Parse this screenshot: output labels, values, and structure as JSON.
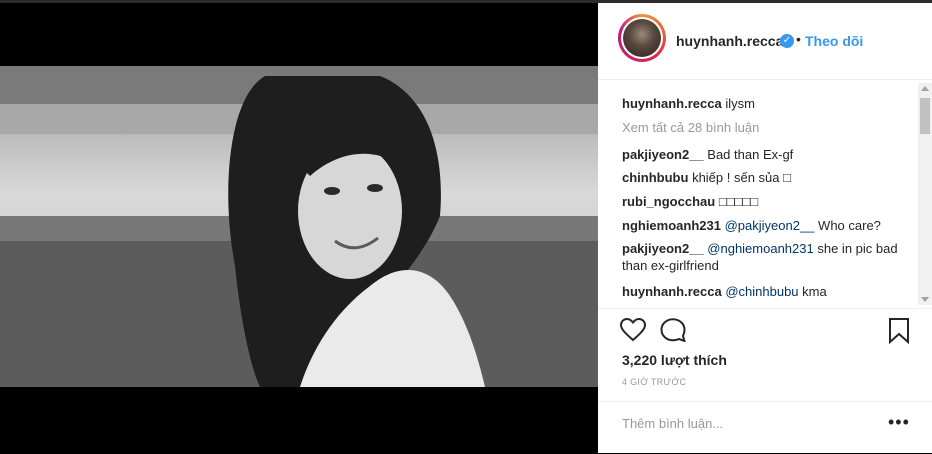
{
  "post": {
    "username": "huynhanh.recca",
    "verified_icon": "verified-badge-icon",
    "separator": "•",
    "follow_label": "Theo dõi",
    "caption": {
      "user": "huynhanh.recca",
      "text": "ilysm"
    },
    "view_all_comments": "Xem tất cả 28 bình luận",
    "comments": [
      {
        "user": "pakjiyeon2__",
        "mention": "",
        "text": "Bad than Ex-gf"
      },
      {
        "user": "chinhbubu",
        "mention": "",
        "text": "khiếp ! sến sủa □"
      },
      {
        "user": "rubi_ngocchau",
        "mention": "",
        "text": "□□□□□"
      },
      {
        "user": "nghiemoanh231",
        "mention": "@pakjiyeon2__",
        "text": "Who care?"
      },
      {
        "user": "pakjiyeon2__",
        "mention": "@nghiemoanh231",
        "text": "she in pic bad than ex-girlfriend"
      },
      {
        "user": "huynhanh.recca",
        "mention": "@chinhbubu",
        "text": "kma"
      }
    ],
    "likes": "3,220 lượt thích",
    "timestamp": "4 GIỜ TRƯỚC",
    "add_comment_placeholder": "Thêm bình luận...",
    "more_options": "•••"
  },
  "icons": {
    "like": "heart-icon",
    "comment": "comment-bubble-icon",
    "save": "bookmark-icon"
  },
  "colors": {
    "link_blue": "#3897f0",
    "mention_blue": "#003569",
    "text": "#262626",
    "muted": "#999999"
  }
}
